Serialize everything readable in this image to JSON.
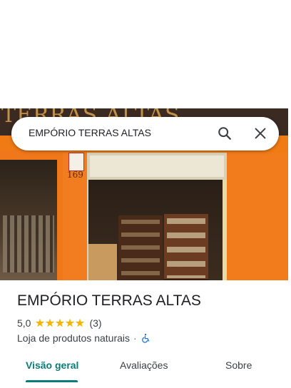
{
  "search": {
    "query": "EMPÓRIO TERRAS ALTAS"
  },
  "photo": {
    "sign_text": "TERRAS ALTAS",
    "house_number": "169"
  },
  "place": {
    "title": "EMPÓRIO TERRAS ALTAS",
    "rating": "5,0",
    "stars": 5,
    "review_count": "(3)",
    "category": "Loja de produtos naturais",
    "separator": "·"
  },
  "tabs": [
    {
      "label": "Visão geral",
      "active": true
    },
    {
      "label": "Avaliações",
      "active": false
    },
    {
      "label": "Sobre",
      "active": false
    }
  ],
  "colors": {
    "accent": "#0a7c7a",
    "star": "#f6b400",
    "wheelchair": "#1a73e8"
  },
  "icons": [
    "search-icon",
    "close-icon",
    "star-icon",
    "wheelchair-icon"
  ]
}
